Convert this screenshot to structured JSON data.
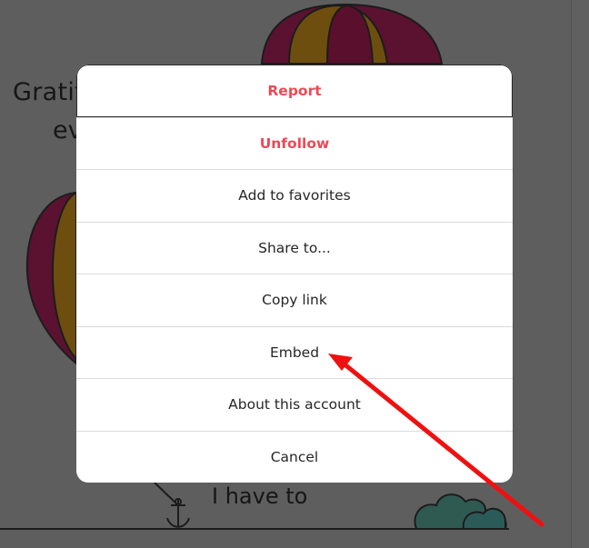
{
  "background_post": {
    "caption_line1": "Gratit",
    "caption_line2": "ev",
    "caption_line3": "I have to"
  },
  "menu": {
    "items": [
      {
        "label": "Report",
        "style": "danger"
      },
      {
        "label": "Unfollow",
        "style": "danger"
      },
      {
        "label": "Add to favorites",
        "style": "normal"
      },
      {
        "label": "Share to...",
        "style": "normal"
      },
      {
        "label": "Copy link",
        "style": "normal"
      },
      {
        "label": "Embed",
        "style": "normal"
      },
      {
        "label": "About this account",
        "style": "normal"
      },
      {
        "label": "Cancel",
        "style": "normal"
      }
    ]
  },
  "annotation": {
    "arrow_color": "#ee1111",
    "points_to": "Embed"
  },
  "colors": {
    "danger": "#ed4956",
    "overlay": "#5e5e5e",
    "dialog_bg": "#ffffff",
    "divider": "#dbdbdb"
  }
}
